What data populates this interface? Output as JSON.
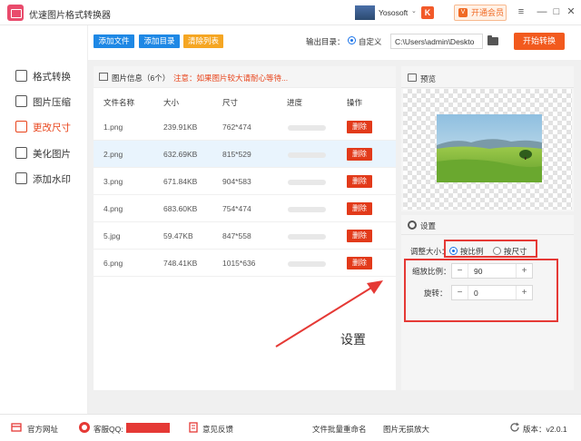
{
  "titlebar": {
    "app_title": "优速图片格式转换器",
    "user_name": "Yososoft",
    "user_caret": "⌄",
    "vip_badge": "K",
    "vip_label": "开通会员",
    "vip_icon": "V",
    "menu_icon": "≡",
    "minimize_icon": "—",
    "maximize_icon": "□",
    "close_icon": "✕"
  },
  "sidebar": {
    "items": [
      {
        "label": "格式转换",
        "icon": "format-convert-icon",
        "active": false
      },
      {
        "label": "图片压缩",
        "icon": "compress-icon",
        "active": false
      },
      {
        "label": "更改尺寸",
        "icon": "resize-icon",
        "active": true
      },
      {
        "label": "美化图片",
        "icon": "beautify-icon",
        "active": false
      },
      {
        "label": "添加水印",
        "icon": "watermark-icon",
        "active": false
      }
    ]
  },
  "toolbar": {
    "add_file": "添加文件",
    "add_folder": "添加目录",
    "clear_list": "清除列表",
    "output_label": "输出目录：",
    "custom_label": "自定义",
    "output_path": "C:\\Users\\admin\\Deskto",
    "start_label": "开始转换",
    "colors": {
      "add": "#1e88e5",
      "clear": "#f5a623",
      "start": "#f25a1e"
    }
  },
  "file_panel": {
    "title": "图片信息（6个）",
    "note": "注意：如果图片较大请耐心等待...",
    "columns": [
      "文件名称",
      "大小",
      "尺寸",
      "进度",
      "操作"
    ],
    "delete_label": "删除",
    "rows": [
      {
        "name": "1.png",
        "size": "239.91KB",
        "dims": "762*474",
        "selected": false
      },
      {
        "name": "2.png",
        "size": "632.69KB",
        "dims": "815*529",
        "selected": true
      },
      {
        "name": "3.png",
        "size": "671.84KB",
        "dims": "904*583",
        "selected": false
      },
      {
        "name": "4.png",
        "size": "683.60KB",
        "dims": "754*474",
        "selected": false
      },
      {
        "name": "5.jpg",
        "size": "59.47KB",
        "dims": "847*558",
        "selected": false
      },
      {
        "name": "6.png",
        "size": "748.41KB",
        "dims": "1015*636",
        "selected": false
      }
    ]
  },
  "preview": {
    "title": "预览"
  },
  "settings": {
    "title": "设置",
    "resize_label": "调整大小：",
    "option_ratio": "按比例",
    "option_size": "按尺寸",
    "selected_option": "按比例",
    "scale_label": "缩放比例：",
    "scale_value": "90",
    "rotate_label": "旋转：",
    "rotate_value": "0",
    "minus": "−",
    "plus": "+"
  },
  "annotation": {
    "text": "设置",
    "color": "#e53935"
  },
  "footer": {
    "website": "官方网址",
    "support_qq": "客服QQ:",
    "feedback": "意见反馈",
    "batch_rename": "文件批量重命名",
    "lossless_enlarge": "图片无损放大",
    "version": "版本：v2.0.1"
  }
}
